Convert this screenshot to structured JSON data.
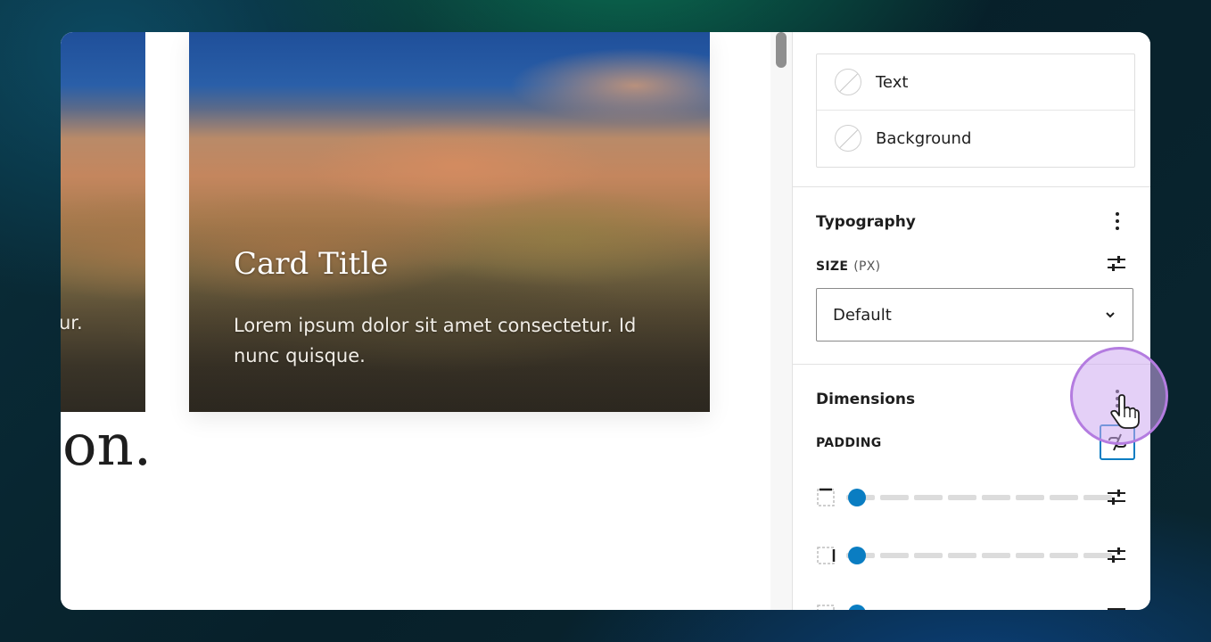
{
  "canvas": {
    "left_card_fragment": "ur.",
    "card": {
      "title": "Card Title",
      "text": "Lorem ipsum dolor sit amet consectetur. Id nunc quisque."
    },
    "heading_fragment": "on."
  },
  "sidebar": {
    "color": {
      "items": [
        {
          "label": "Text",
          "icon": "empty-swatch-icon"
        },
        {
          "label": "Background",
          "icon": "empty-swatch-icon"
        }
      ]
    },
    "typography": {
      "title": "Typography",
      "size_label": "SIZE",
      "size_unit": "(PX)",
      "size_value": "Default"
    },
    "dimensions": {
      "title": "Dimensions",
      "padding_label": "PADDING",
      "padding_rows": [
        {
          "side": "top",
          "value": 0
        },
        {
          "side": "right",
          "value": 0
        },
        {
          "side": "bottom",
          "value": 0
        }
      ]
    }
  },
  "colors": {
    "accent": "#0a7dc2",
    "cursor_highlight": "#b47ce0"
  }
}
